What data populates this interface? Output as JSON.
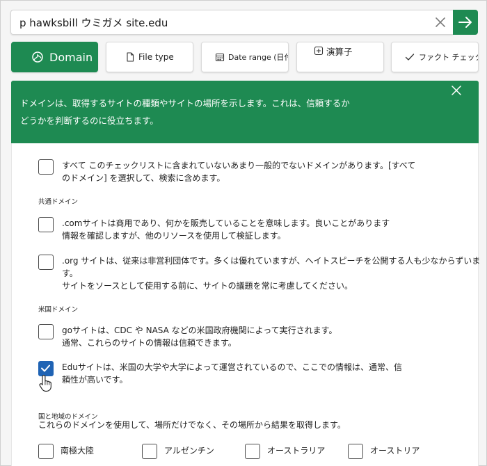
{
  "search": {
    "query": "p hawksbill ウミガメ site.edu"
  },
  "toolbar": {
    "domain": "Domain",
    "filetype": "File type",
    "daterange": "Date range (日付範囲",
    "operators": "演算子",
    "factcheck": "ファクト チェック"
  },
  "banner": {
    "line1": "ドメインは、取得するサイトの種類やサイトの場所を示します。これは、信頼するか",
    "line2": "どうかを判断するのに役立ちます。"
  },
  "options": {
    "all": {
      "line1": "すべて このチェックリストに含まれていないあまり一般的でないドメインがあります。[すべて",
      "line2": "のドメイン] を選択して、検索に含めます。"
    },
    "common_header": "共通ドメイン",
    "com": {
      "line1": ".comサイトは商用であり、何かを販売していることを意味します。良いことがあります",
      "line2": "情報を確認しますが、他のリソースを使用して検証します。"
    },
    "org": {
      "line1": ".org サイトは、従来は非営利団体です。多くは優れていますが、ヘイトスピーチを公開する人も少なからずいます。",
      "line2": "サイトをソースとして使用する前に、サイトの議題を常に考慮してください。"
    },
    "us_header": "米国ドメイン",
    "gov": {
      "line1": "goサイトは、CDC や NASA などの米国政府機関によって実行されます。",
      "line2": "通常、これらのサイトの情報は信頼できます。"
    },
    "edu": {
      "line1": "Eduサイトは、米国の大学や大学によって運営されているので、ここでの情報は、通常、信",
      "line2": "頼性が高いです。",
      "checked": true
    },
    "country_header": "国と地域のドメイン",
    "country_desc": "これらのドメインを使用して、場所だけでなく、その場所から結果を取得します。",
    "regions": [
      "南極大陸",
      "アルゼンチン",
      "オーストラリア",
      "オーストリア"
    ]
  },
  "colors": {
    "accent": "#1e8a52",
    "checkbox_checked": "#1f63b4"
  }
}
